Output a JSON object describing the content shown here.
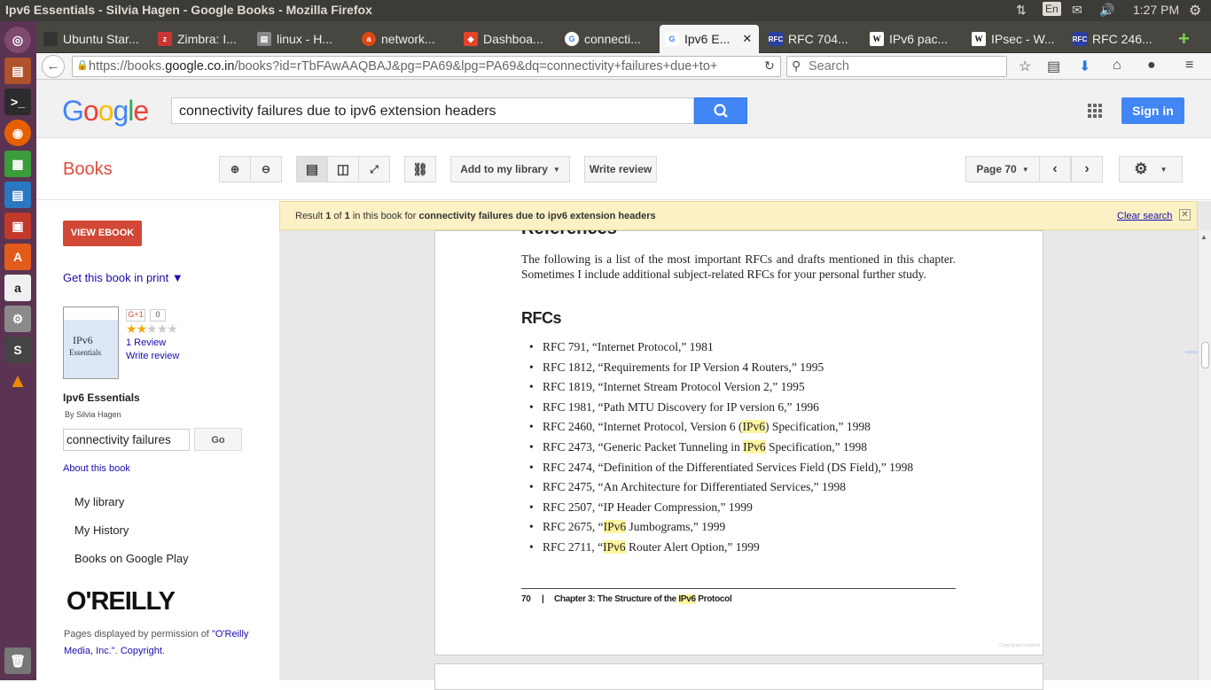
{
  "os": {
    "window_title": "Ipv6 Essentials - Silvia Hagen - Google Books - Mozilla Firefox",
    "keyboard_layout": "En",
    "clock": "1:27 PM"
  },
  "tabs": [
    {
      "label": "Ubuntu Star...",
      "favicon": "ubuntu-icon"
    },
    {
      "label": "Zimbra: I...",
      "favicon": "zimbra-icon"
    },
    {
      "label": "linux - H...",
      "favicon": "stackoverflow-icon"
    },
    {
      "label": "network...",
      "favicon": "askubuntu-icon"
    },
    {
      "label": "Dashboa...",
      "favicon": "gitlab-icon"
    },
    {
      "label": "connecti...",
      "favicon": "google-icon"
    },
    {
      "label": "Ipv6 E...",
      "favicon": "google-icon"
    },
    {
      "label": "RFC 704...",
      "favicon": "rfc-icon"
    },
    {
      "label": "IPv6 pac...",
      "favicon": "wikipedia-icon"
    },
    {
      "label": "IPsec - W...",
      "favicon": "wikipedia-icon"
    },
    {
      "label": "RFC 246...",
      "favicon": "rfc-icon"
    }
  ],
  "nav": {
    "url_prefix": "https://books.",
    "url_domain": "google.co.in",
    "url_rest": "/books?id=rTbFAwAAQBAJ&pg=PA69&lpg=PA69&dq=connectivity+failures+due+to+",
    "search_placeholder": "Search"
  },
  "google": {
    "query": "connectivity failures due to ipv6 extension headers",
    "sign_in": "Sign in"
  },
  "books": {
    "section": "Books",
    "add_to_library": "Add to my library",
    "write_review": "Write review",
    "page_label": "Page 70"
  },
  "sidebar": {
    "view_ebook": "VIEW EBOOK",
    "get_print": "Get this book in print ▼",
    "plus_count": "0",
    "reviews": "1 Review",
    "write_review": "Write review",
    "book_title": "Ipv6 Essentials",
    "author": "By Silvia Hagen",
    "search_value": "connectivity failures",
    "go": "Go",
    "about": "About this book",
    "my_library": "My library",
    "my_history": "My History",
    "play": "Books on Google Play",
    "publisher_logo": "O'REILLY",
    "permission_1": "Pages displayed by permission of ",
    "permission_link": "\"O'Reilly Media, Inc.\"",
    "copyright": "Copyright",
    "rating": 2
  },
  "result": {
    "prefix": "Result ",
    "num": "1",
    "of": " of ",
    "total": "1",
    "middle": " in this book for ",
    "query": "connectivity failures due to ipv6 extension headers",
    "clear": "Clear search"
  },
  "page": {
    "heading_cut": "References",
    "intro": "The following is a list of the most important RFCs and drafts mentioned in this chapter. Sometimes I include additional subject-related RFCs for your personal further study.",
    "rfcs_heading": "RFCs",
    "items": [
      {
        "a": "RFC 791, “Internet Protocol,” 1981"
      },
      {
        "a": "RFC 1812, “Requirements for IP Version 4 Routers,” 1995"
      },
      {
        "a": "RFC 1819, “Internet Stream Protocol Version 2,” 1995"
      },
      {
        "a": "RFC 1981, “Path MTU Discovery for IP version 6,” 1996"
      },
      {
        "a": "RFC 2460, “Internet Protocol, Version 6 (",
        "hl": "IPv6",
        "b": ") Specification,” 1998"
      },
      {
        "a": "RFC 2473, “Generic Packet Tunneling in ",
        "hl": "IPv6",
        "b": " Specification,” 1998"
      },
      {
        "a": "RFC 2474, “Definition of the Differentiated Services Field (DS Field),” 1998"
      },
      {
        "a": "RFC 2475, “An Architecture for Differentiated Services,” 1998"
      },
      {
        "a": "RFC 2507, “IP Header Compression,” 1999"
      },
      {
        "a": "RFC 2675, “",
        "hl": "IPv6",
        "b": " Jumbograms,” 1999"
      },
      {
        "a": "RFC 2711, “",
        "hl": "IPv6",
        "b": " Router Alert Option,” 1999"
      }
    ],
    "footer_num": "70",
    "footer_sep": "|",
    "footer_a": "Chapter 3: The Structure of the ",
    "footer_hl": "IPv6",
    "footer_b": " Protocol",
    "copyright_mark": "Copyrighted material"
  }
}
